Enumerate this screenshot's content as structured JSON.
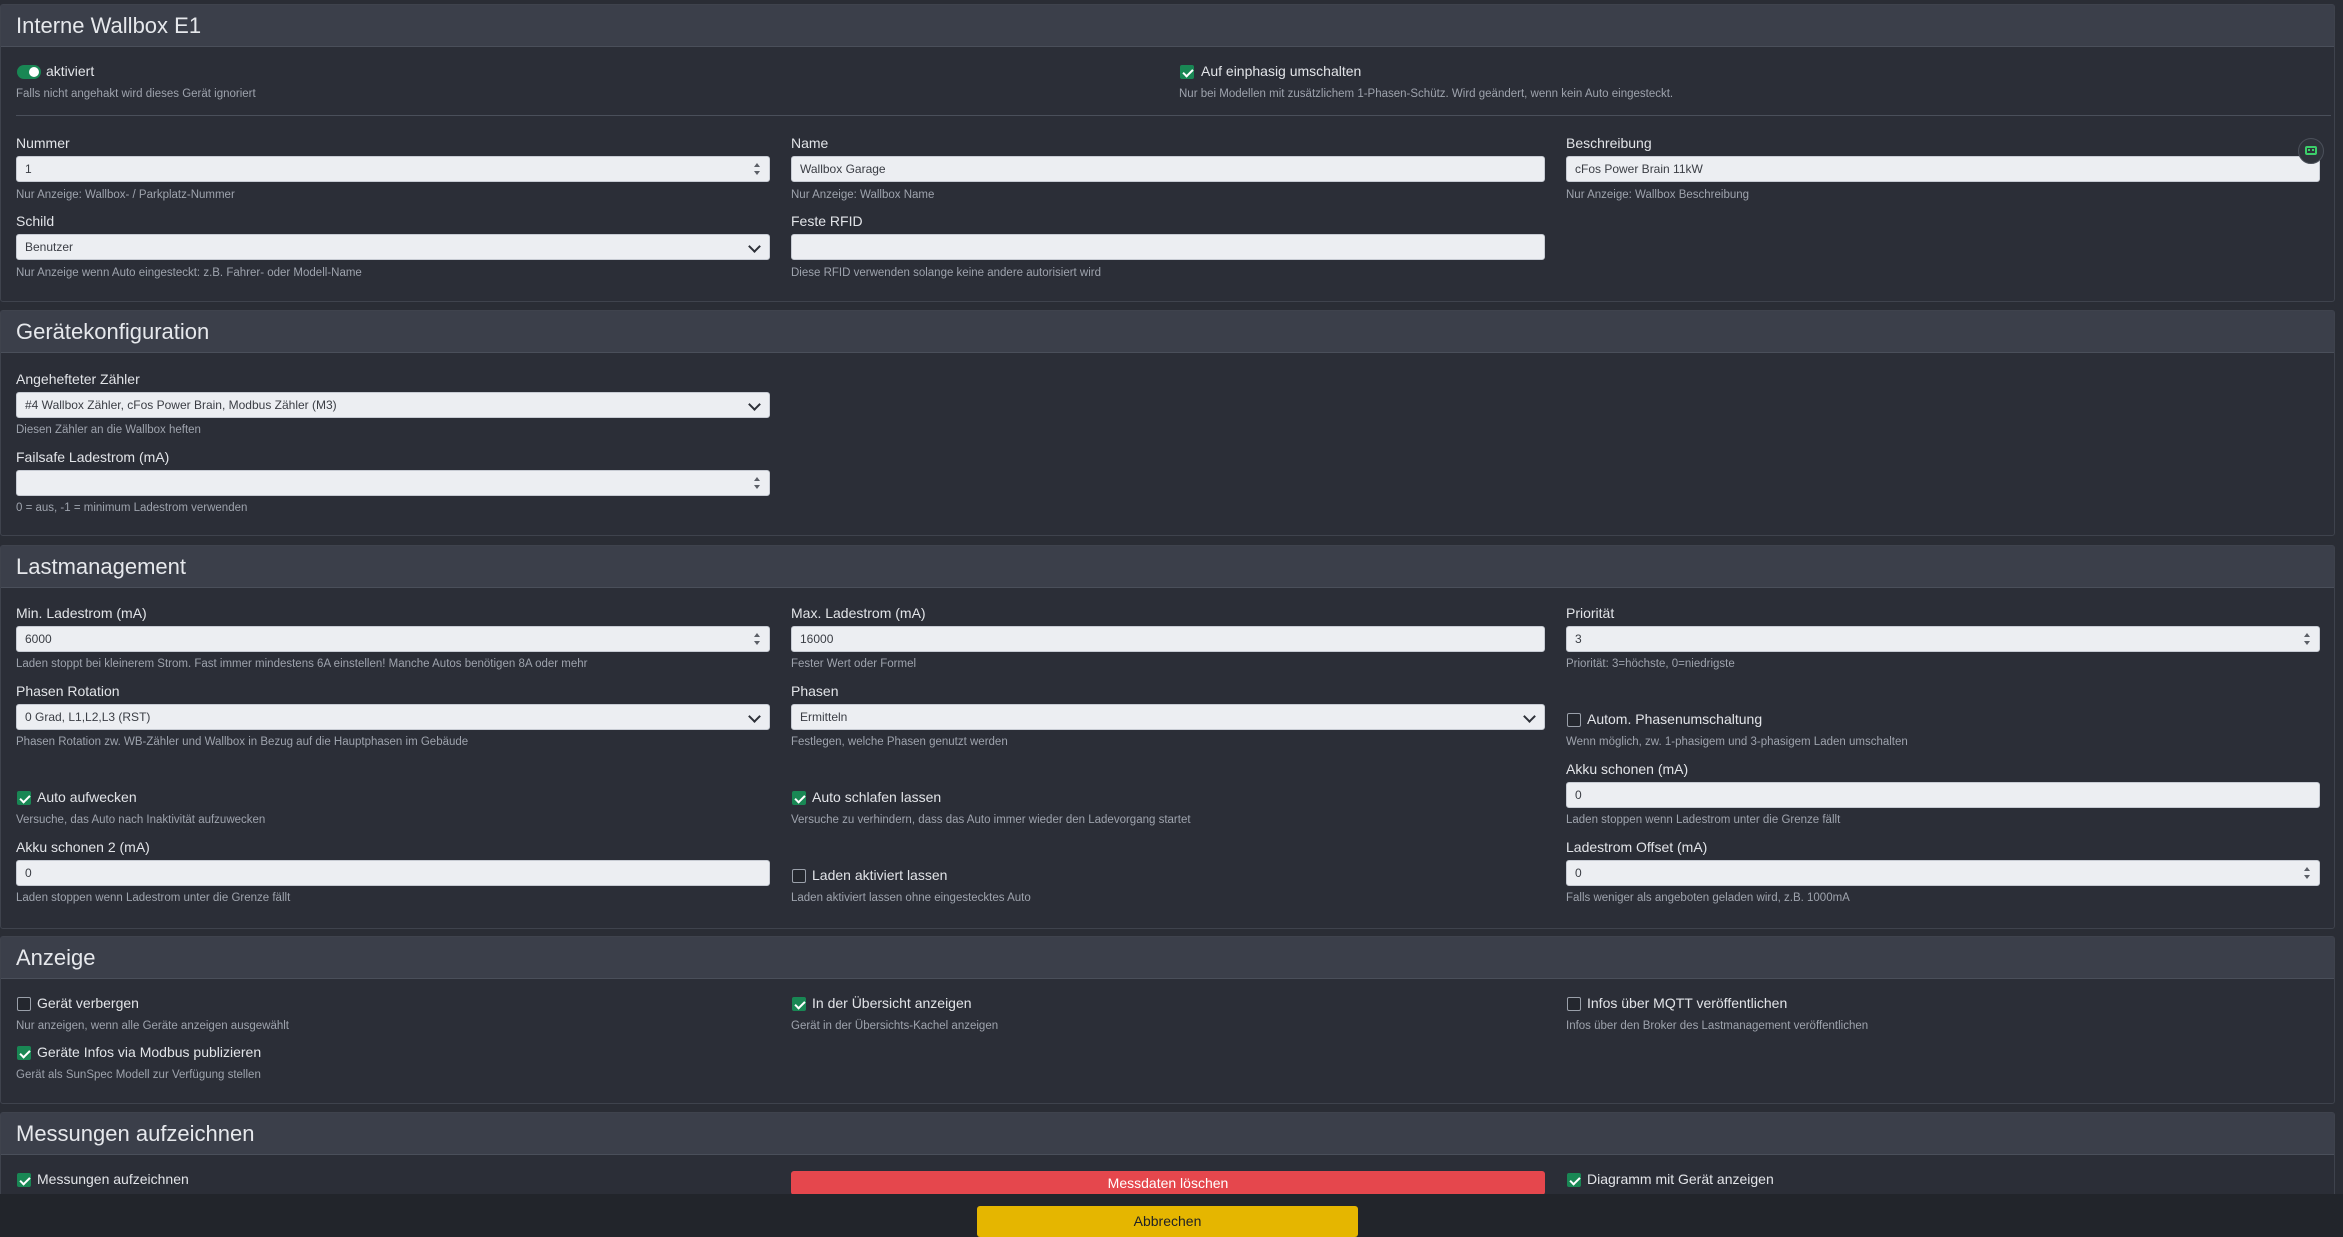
{
  "wallbox": {
    "title": "Interne Wallbox E1",
    "enabled_label": "aktiviert",
    "enabled_hint": "Falls nicht angehakt wird dieses Gerät ignoriert",
    "single_phase_label": "Auf einphasig umschalten",
    "single_phase_hint": "Nur bei Modellen mit zusätzlichem 1-Phasen-Schütz. Wird geändert, wenn kein Auto eingesteckt.",
    "number_label": "Nummer",
    "number_value": "1",
    "number_hint": "Nur Anzeige: Wallbox- / Parkplatz-Nummer",
    "name_label": "Name",
    "name_value": "Wallbox Garage",
    "name_hint": "Nur Anzeige: Wallbox Name",
    "desc_label": "Beschreibung",
    "desc_value": "cFos Power Brain 11kW",
    "desc_hint": "Nur Anzeige: Wallbox Beschreibung",
    "sign_label": "Schild",
    "sign_value": "Benutzer",
    "sign_hint": "Nur Anzeige wenn Auto eingesteckt: z.B. Fahrer- oder Modell-Name",
    "rfid_label": "Feste RFID",
    "rfid_value": "",
    "rfid_hint": "Diese RFID verwenden solange keine andere autorisiert wird"
  },
  "device_config": {
    "title": "Gerätekonfiguration",
    "meter_label": "Angehefteter Zähler",
    "meter_value": "#4 Wallbox Zähler, cFos Power Brain, Modbus Zähler (M3)",
    "meter_hint": "Diesen Zähler an die Wallbox heften",
    "failsafe_label": "Failsafe Ladestrom (mA)",
    "failsafe_value": "",
    "failsafe_hint": "0 = aus, -1 = minimum Ladestrom verwenden"
  },
  "load": {
    "title": "Lastmanagement",
    "min_label": "Min. Ladestrom (mA)",
    "min_value": "6000",
    "min_hint": "Laden stoppt bei kleinerem Strom. Fast immer mindestens 6A einstellen! Manche Autos benötigen 8A oder mehr",
    "max_label": "Max. Ladestrom (mA)",
    "max_value": "16000",
    "max_hint": "Fester Wert oder Formel",
    "prio_label": "Priorität",
    "prio_value": "3",
    "prio_hint": "Priorität: 3=höchste, 0=niedrigste",
    "rot_label": "Phasen Rotation",
    "rot_value": "0 Grad, L1,L2,L3 (RST)",
    "rot_hint": "Phasen Rotation zw. WB-Zähler und Wallbox in Bezug auf die Hauptphasen im Gebäude",
    "phases_label": "Phasen",
    "phases_value": "Ermitteln",
    "phases_hint": "Festlegen, welche Phasen genutzt werden",
    "auto_switch_label": "Autom. Phasenumschaltung",
    "auto_switch_hint": "Wenn möglich, zw. 1-phasigem und 3-phasigem Laden umschalten",
    "wake_label": "Auto aufwecken",
    "wake_hint": "Versuche, das Auto nach Inaktivität aufzuwecken",
    "sleep_label": "Auto schlafen lassen",
    "sleep_hint": "Versuche zu verhindern, dass das Auto immer wieder den Ladevorgang startet",
    "akku_label": "Akku schonen (mA)",
    "akku_value": "0",
    "akku_hint": "Laden stoppen wenn Ladestrom unter die Grenze fällt",
    "akku2_label": "Akku schonen 2 (mA)",
    "akku2_value": "0",
    "akku2_hint": "Laden stoppen wenn Ladestrom unter die Grenze fällt",
    "keep_label": "Laden aktiviert lassen",
    "keep_hint": "Laden aktiviert lassen ohne eingestecktes Auto",
    "offset_label": "Ladestrom Offset (mA)",
    "offset_value": "0",
    "offset_hint": "Falls weniger als angeboten geladen wird, z.B. 1000mA"
  },
  "display": {
    "title": "Anzeige",
    "hide_label": "Gerät verbergen",
    "hide_hint": "Nur anzeigen, wenn alle Geräte anzeigen ausgewählt",
    "overview_label": "In der Übersicht anzeigen",
    "overview_hint": "Gerät in der Übersichts-Kachel anzeigen",
    "mqtt_label": "Infos über MQTT veröffentlichen",
    "mqtt_hint": "Infos über den Broker des Lastmanagement veröffentlichen",
    "modbus_label": "Geräte Infos via Modbus publizieren",
    "modbus_hint": "Gerät als SunSpec Modell zur Verfügung stellen"
  },
  "measure": {
    "title": "Messungen aufzeichnen",
    "record_label": "Messungen aufzeichnen",
    "delete_label": "Messdaten löschen",
    "chart_label": "Diagramm mit Gerät anzeigen"
  },
  "footer": {
    "cancel_label": "Abbrechen"
  },
  "icons": {
    "floating": "bot-icon"
  },
  "colors": {
    "accent_green": "#198754",
    "danger": "#e5474d",
    "warning": "#e5b600"
  }
}
